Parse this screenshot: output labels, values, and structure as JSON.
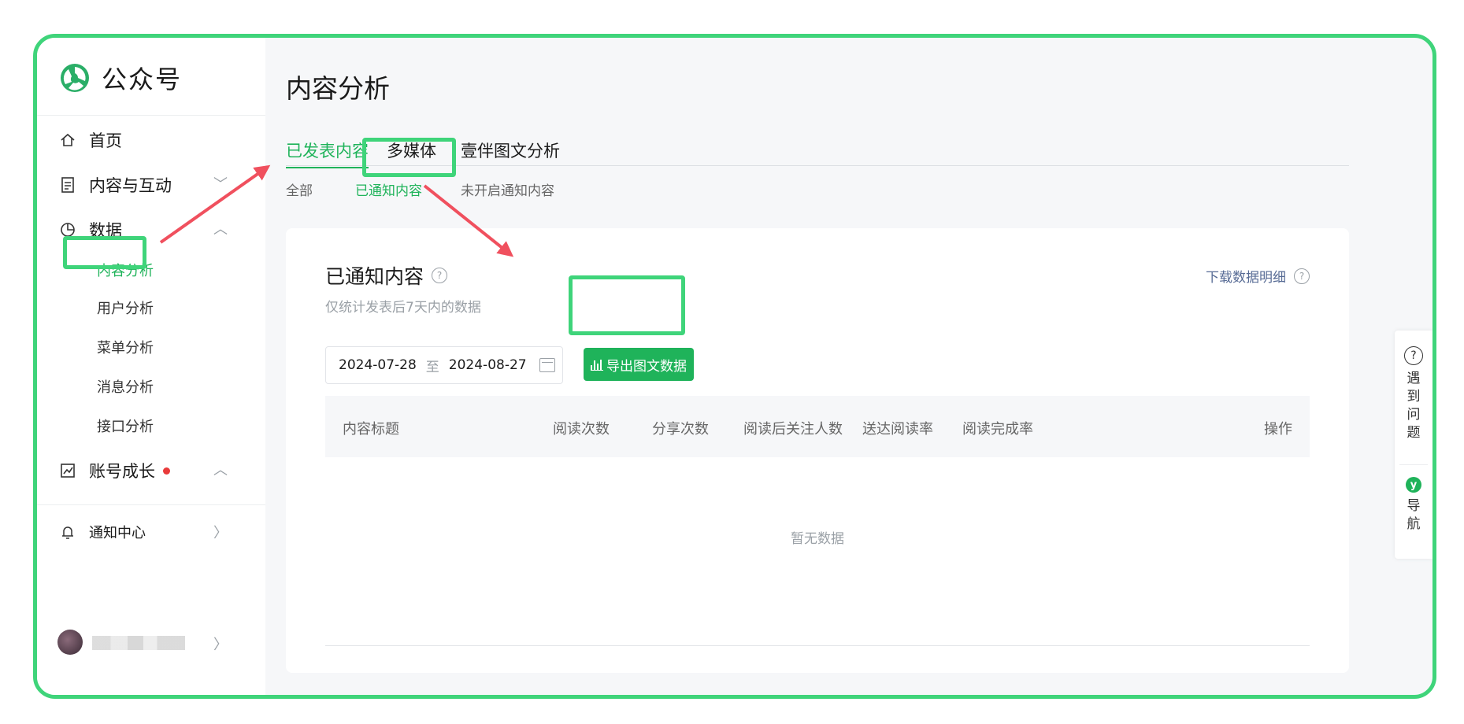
{
  "brand": {
    "name": "公众号",
    "logo_icon": "wechat-official-account-logo",
    "accent": "#1fb35a"
  },
  "sidebar": {
    "items": [
      {
        "label": "首页",
        "icon": "home-icon"
      },
      {
        "label": "内容与互动",
        "icon": "document-icon",
        "chevron": "﹀"
      },
      {
        "label": "数据",
        "icon": "pie-chart-icon",
        "chevron": "︿"
      },
      {
        "label": "账号成长",
        "icon": "trend-chart-icon",
        "chevron": "︿",
        "badge": "red-dot"
      },
      {
        "label": "通知中心",
        "icon": "bell-icon",
        "chevron": "〉"
      }
    ],
    "data_subitems": [
      "内容分析",
      "用户分析",
      "菜单分析",
      "消息分析",
      "接口分析"
    ],
    "active_subitem": "内容分析",
    "user_chevron": "〉"
  },
  "main": {
    "title": "内容分析",
    "tabs": [
      "已发表内容",
      "多媒体",
      "壹伴图文分析"
    ],
    "active_tab": "已发表内容",
    "subtabs": [
      "全部",
      "已通知内容",
      "未开启通知内容"
    ],
    "active_subtab": "已通知内容"
  },
  "card": {
    "title": "已通知内容",
    "help": "?",
    "subtitle": "仅统计发表后7天内的数据",
    "download_label": "下载数据明细",
    "date_start": "2024-07-28",
    "date_sep": "至",
    "date_end": "2024-08-27",
    "export_label": "导出图文数据",
    "columns": [
      "内容标题",
      "阅读次数",
      "分享次数",
      "阅读后关注人数",
      "送达阅读率",
      "阅读完成率",
      "操作"
    ],
    "empty_text": "暂无数据"
  },
  "help_panel": {
    "help_text": "遇到问题",
    "help_icon": "?",
    "nav_text": "导航",
    "nav_icon": "y"
  }
}
